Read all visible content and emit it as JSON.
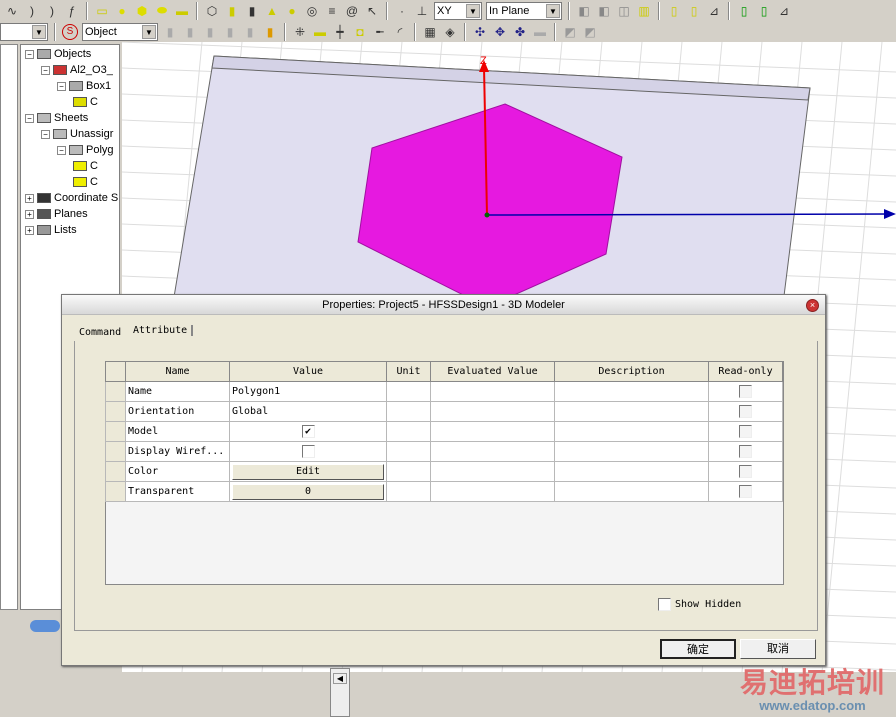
{
  "toolbar": {
    "select_mode": "Object",
    "plane": "XY",
    "plane_mode": "In Plane"
  },
  "tree": {
    "items": [
      {
        "label": "Objects",
        "expander": "−"
      },
      {
        "label": "Al2_O3_",
        "expander": "−"
      },
      {
        "label": "Box1",
        "expander": "−"
      },
      {
        "label": "C"
      },
      {
        "label": "Sheets",
        "expander": "−"
      },
      {
        "label": "Unassigr",
        "expander": "−"
      },
      {
        "label": "Polyg",
        "expander": "−"
      },
      {
        "label": "C"
      },
      {
        "label": "C"
      },
      {
        "label": "Coordinate S",
        "expander": "+"
      },
      {
        "label": "Planes",
        "expander": "+"
      },
      {
        "label": "Lists",
        "expander": "+"
      }
    ]
  },
  "viewport": {
    "axis_z_label": "Z",
    "hexagon_color": "#e619e0",
    "slab_color": "#e0def0"
  },
  "dialog": {
    "title": "Properties: Project5 - HFSSDesign1 - 3D Modeler",
    "close": "×",
    "tabs": [
      "Command",
      "Attribute"
    ],
    "columns": [
      "Name",
      "Value",
      "Unit",
      "Evaluated Value",
      "Description",
      "Read-only"
    ],
    "rows": [
      {
        "name": "Name",
        "value": "Polygon1",
        "type": "text"
      },
      {
        "name": "Orientation",
        "value": "Global",
        "type": "text"
      },
      {
        "name": "Model",
        "value": "✔",
        "type": "check",
        "checked": true
      },
      {
        "name": "Display Wiref...",
        "value": "",
        "type": "check",
        "checked": false
      },
      {
        "name": "Color",
        "value": "Edit",
        "type": "button"
      },
      {
        "name": "Transparent",
        "value": "0",
        "type": "button"
      }
    ],
    "show_hidden": "Show Hidden",
    "ok": "确定",
    "cancel": "取消"
  },
  "watermark": {
    "title": "易迪拓培训",
    "url": "www.edatop.com"
  }
}
